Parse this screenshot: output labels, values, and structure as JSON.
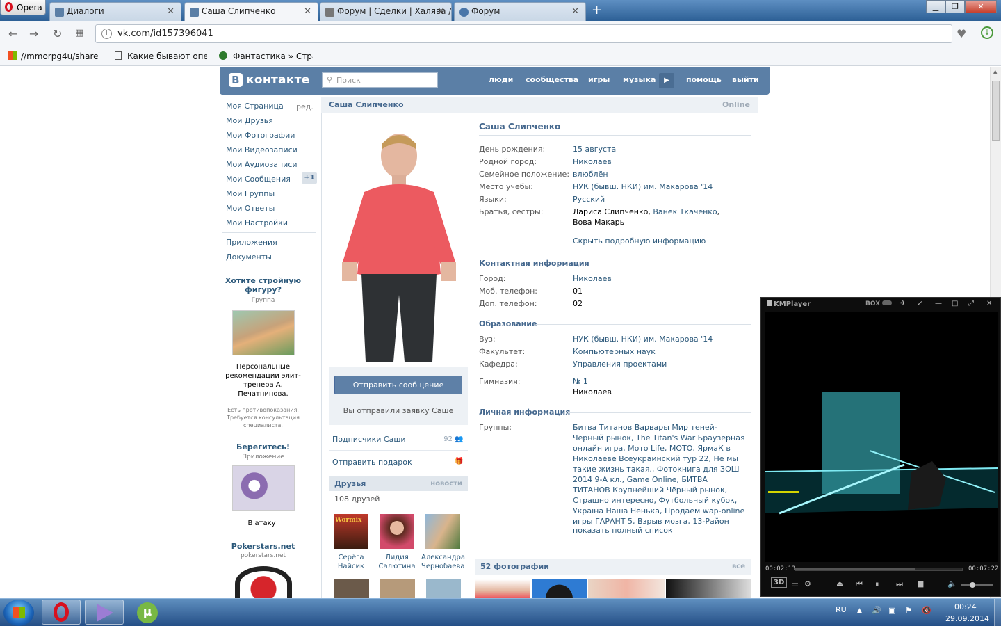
{
  "browser": {
    "menu_label": "Opera",
    "tabs": [
      {
        "title": "Диалоги",
        "favicon_color": "#5b7fa6"
      },
      {
        "title": "Саша Слипченко",
        "favicon_color": "#5b7fa6"
      },
      {
        "title": "Форум | Сделки | Халява / ",
        "favicon_color": "#777777"
      },
      {
        "title": "Форум",
        "favicon_color": "#4a76a8"
      }
    ],
    "active_tab": 1,
    "new_tab_symbol": "+",
    "url": "vk.com/id157396041",
    "bookmarks": [
      "//mmorpg4u/share ",
      "Какие бывают опера",
      "Фантастика » Страни"
    ]
  },
  "vk": {
    "logo": "контакте",
    "logo_letter": "В",
    "search_placeholder": "Поиск",
    "nav": [
      "люди",
      "сообщества",
      "игры",
      "музыка",
      "помощь",
      "выйти"
    ],
    "menu": [
      "Моя Страница",
      "Мои Друзья",
      "Мои Фотографии",
      "Мои Видеозаписи",
      "Мои Аудиозаписи",
      "Мои Сообщения",
      "Мои Группы",
      "Мои Ответы",
      "Мои Настройки"
    ],
    "menu_edit": "ред.",
    "messages_badge": "+1",
    "menu_extra": [
      "Приложения",
      "Документы"
    ],
    "ads": [
      {
        "title": "Хотите стройную фигуру?",
        "sub": "Группа",
        "text": "Персональные рекомендации элит-тренера А. Печатнинова.",
        "small": "Есть противопоказания. Требуется консультация специалиста."
      },
      {
        "title": "Берегитесь!",
        "sub": "Приложение",
        "text": "В атаку!"
      },
      {
        "title": "Pokerstars.net",
        "sub": "pokerstars.net"
      }
    ]
  },
  "profile": {
    "name": "Саша Слипченко",
    "status": "Online",
    "send_message": "Отправить сообщение",
    "request_sent": "Вы отправили заявку Саше",
    "subscribers_label": "Подписчики Саши",
    "subscribers_count": "92",
    "gift_label": "Отправить подарок",
    "friends_title": "Друзья",
    "friends_new": "новости",
    "friends_count": "108 друзей",
    "friends": [
      {
        "name": "Серёга Найсик",
        "badge": "Wormix"
      },
      {
        "name": "Лидия Салютина"
      },
      {
        "name": "Александра Чернобаева"
      }
    ],
    "info": {
      "basic": [
        {
          "label": "День рождения:",
          "value": "15 августа"
        },
        {
          "label": "Родной город:",
          "value": "Николаев"
        },
        {
          "label": "Семейное положение:",
          "value": "влюблён"
        },
        {
          "label": "Место учебы:",
          "value": "НУК (бывш. НКИ) им. Макарова '14"
        },
        {
          "label": "Языки:",
          "value": "Русский"
        },
        {
          "label": "Братья, сестры:",
          "value_a": "Лариса Слипченко",
          "value_link": "Ванек Ткаченко",
          "value_b": "Вова Макарь"
        }
      ],
      "hide_link": "Скрыть подробную информацию",
      "contact_title": "Контактная информация",
      "contact": [
        {
          "label": "Город:",
          "value": "Николаев"
        },
        {
          "label": "Моб. телефон:",
          "value": "01"
        },
        {
          "label": "Доп. телефон:",
          "value": "02"
        }
      ],
      "edu_title": "Образование",
      "edu": [
        {
          "label": "Вуз:",
          "value": "НУК (бывш. НКИ) им. Макарова '14"
        },
        {
          "label": "Факультет:",
          "value": "Компьютерных наук"
        },
        {
          "label": "Кафедра:",
          "value": "Управления проектами"
        },
        {
          "label": "Гимназия:",
          "value": "№ 1",
          "value2": "Николаев"
        }
      ],
      "personal_title": "Личная информация",
      "groups_label": "Группы:",
      "groups": "Битва Титанов Варвары Мир теней-Чёрный рынок, The Titan's War Браузерная онлайн игра, Мото Life, МОТО, ЯрмаК в Николаеве Всеукраинский тур 22, Не мы такие жизнь такая., Фотокнига для ЗОШ 2014 9-А кл., Game Online, БИТВА ТИТАНОВ Крупнейший Чёрный рынок, Страшно интересно, Футбольный кубок, Україна Наша Ненька, Продаем wap-online игры ГАРАНТ 5, Взрыв мозга, 13-Район",
      "full_list": "показать полный список",
      "photos_title": "52 фотографии",
      "photos_all": "все"
    }
  },
  "kmplayer": {
    "title": "KMPlayer",
    "box_label": "BOX",
    "time_current": "00:02:13",
    "time_total": "00:07:22",
    "progress": 0.72,
    "mode_3d": "3D"
  },
  "taskbar": {
    "lang": "RU",
    "time": "00:24",
    "date": "29.09.2014"
  }
}
